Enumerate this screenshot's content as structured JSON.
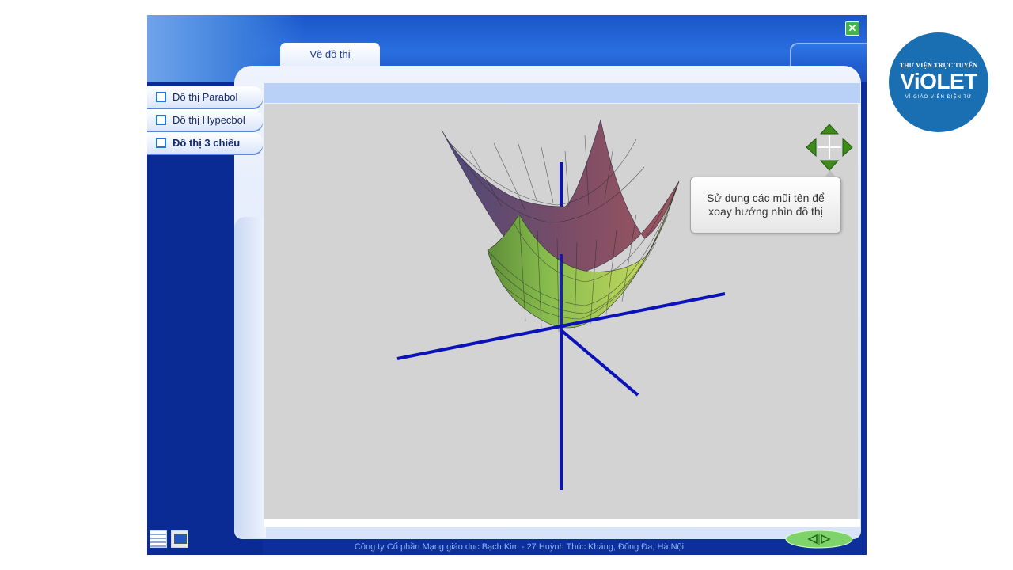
{
  "window": {
    "active_tab_label": "Vẽ đồ thị",
    "close_icon": "close-icon",
    "accent": "#0c2f9c"
  },
  "sidebar": {
    "items": [
      {
        "label": "Đồ thị Parabol",
        "active": false
      },
      {
        "label": "Đồ thị Hypecbol",
        "active": false
      },
      {
        "label": "Đồ thị 3 chiều",
        "active": true
      }
    ]
  },
  "viewer": {
    "tooltip_text": "Sử dụng các mũi tên để xoay hướng nhìn đồ thị",
    "nav_icon": "rotate-arrows-icon",
    "surface": "paraboloid",
    "axis_color": "#0b12b8"
  },
  "footer": {
    "company_text": "Công ty Cổ phần Mạng giáo dục Bạch Kim - 27 Huỳnh Thúc Kháng, Đống Đa, Hà Nội",
    "prev_icon": "prev-icon",
    "next_icon": "next-icon"
  },
  "logo": {
    "top_text": "THƯ VIỆN TRỰC TUYẾN",
    "main_text": "ViOLET",
    "sub_text": "VÌ GIÁO VIÊN ĐIỆN TỬ"
  }
}
